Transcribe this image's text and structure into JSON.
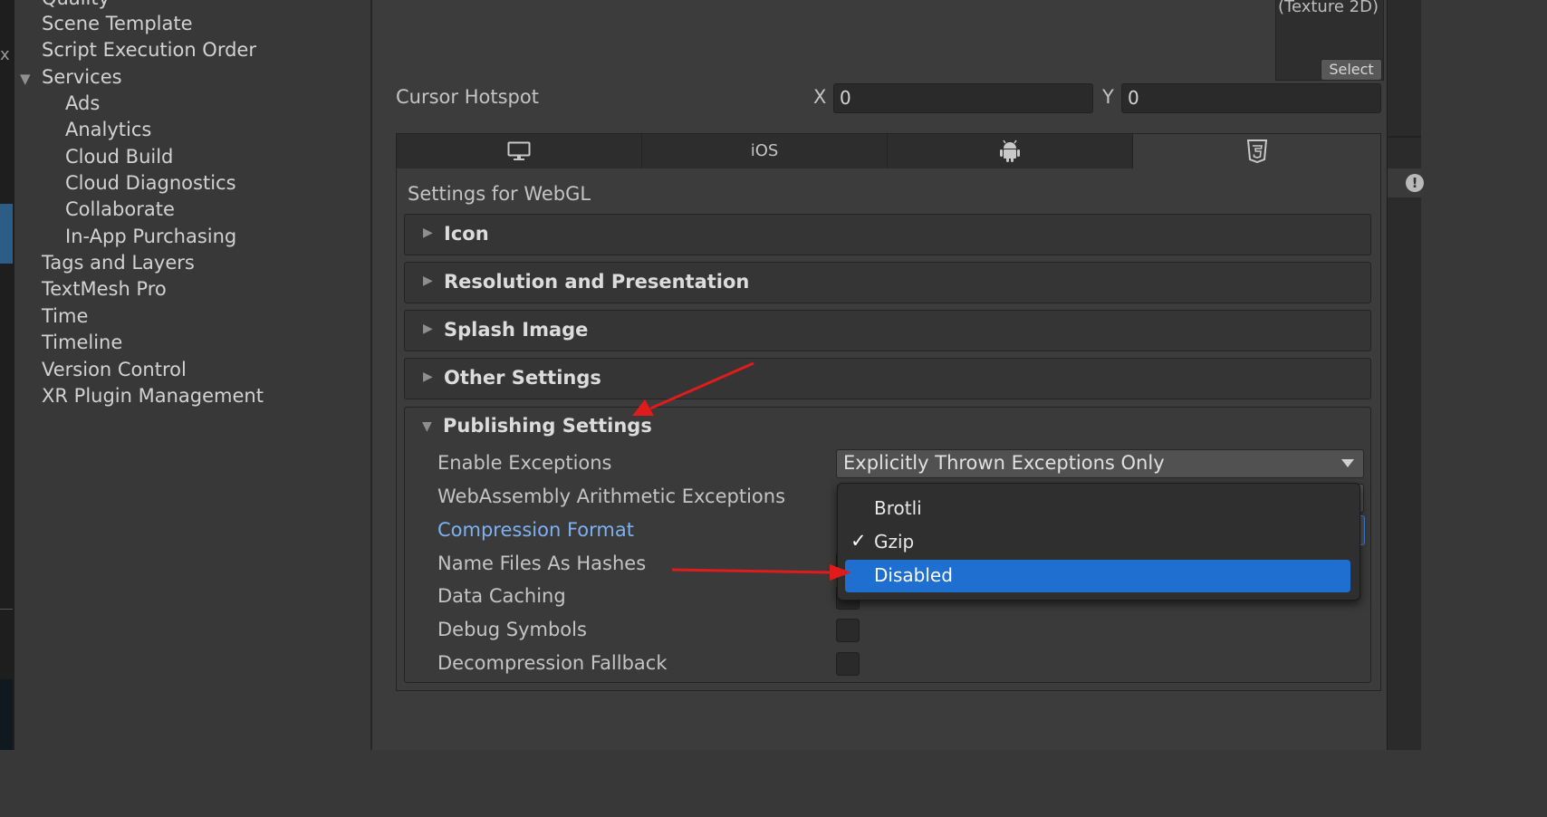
{
  "sidebar": {
    "items": [
      {
        "label": "Quality",
        "indent": 0
      },
      {
        "label": "Scene Template",
        "indent": 0
      },
      {
        "label": "Script Execution Order",
        "indent": 0
      },
      {
        "label": "Services",
        "indent": 0,
        "expanded": true
      },
      {
        "label": "Ads",
        "indent": 1
      },
      {
        "label": "Analytics",
        "indent": 1
      },
      {
        "label": "Cloud Build",
        "indent": 1
      },
      {
        "label": "Cloud Diagnostics",
        "indent": 1
      },
      {
        "label": "Collaborate",
        "indent": 1
      },
      {
        "label": "In-App Purchasing",
        "indent": 1
      },
      {
        "label": "Tags and Layers",
        "indent": 0
      },
      {
        "label": "TextMesh Pro",
        "indent": 0
      },
      {
        "label": "Time",
        "indent": 0
      },
      {
        "label": "Timeline",
        "indent": 0
      },
      {
        "label": "Version Control",
        "indent": 0
      },
      {
        "label": "XR Plugin Management",
        "indent": 0
      }
    ]
  },
  "left_strip": {
    "close_glyph": "x"
  },
  "texture": {
    "type_label": "(Texture 2D)",
    "select_label": "Select"
  },
  "cursor_hotspot": {
    "label": "Cursor Hotspot",
    "x_label": "X",
    "x_value": "0",
    "y_label": "Y",
    "y_value": "0"
  },
  "tabs": [
    {
      "icon": "desktop-icon",
      "label": ""
    },
    {
      "icon": "",
      "label": "iOS"
    },
    {
      "icon": "android-icon",
      "label": ""
    },
    {
      "icon": "html5-icon",
      "label": "",
      "active": true
    }
  ],
  "settings": {
    "heading": "Settings for WebGL",
    "foldouts": [
      "Icon",
      "Resolution and Presentation",
      "Splash Image",
      "Other Settings"
    ],
    "publishing": {
      "title": "Publishing Settings",
      "rows": [
        {
          "label": "Enable Exceptions",
          "control": "dropdown",
          "value": "Explicitly Thrown Exceptions Only"
        },
        {
          "label": "WebAssembly Arithmetic Exceptions",
          "control": "dropdown"
        },
        {
          "label": "Compression Format",
          "control": "dropdown",
          "focused": true
        },
        {
          "label": "Name Files As Hashes",
          "control": "checkbox"
        },
        {
          "label": "Data Caching",
          "control": "checkbox"
        },
        {
          "label": "Debug Symbols",
          "control": "checkbox"
        },
        {
          "label": "Decompression Fallback",
          "control": "checkbox"
        }
      ]
    }
  },
  "popup": {
    "options": [
      {
        "label": "Brotli",
        "checked": false,
        "highlighted": false
      },
      {
        "label": "Gzip",
        "checked": true,
        "highlighted": false
      },
      {
        "label": "Disabled",
        "checked": false,
        "highlighted": true
      }
    ],
    "check_glyph": "✓"
  },
  "colors": {
    "accent": "#1f6fd0",
    "annotation_arrow": "#e01b1b",
    "focused_label": "#7eb1ef"
  }
}
